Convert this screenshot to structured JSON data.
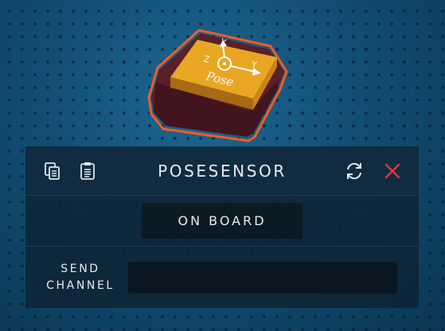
{
  "scene": {
    "block_label": "Pose",
    "axis_labels": {
      "x": "X",
      "y": "Y",
      "z": "Z"
    }
  },
  "panel": {
    "title": "POSESENSOR",
    "mode_button_label": "ON BOARD",
    "send_channel_label_line1": "SEND",
    "send_channel_label_line2": "CHANNEL",
    "send_channel_value": ""
  },
  "icons": [
    "copy-icon",
    "paste-icon",
    "refresh-icon",
    "close-icon"
  ],
  "colors": {
    "block_orange": "#e8a623",
    "selection_outline": "#ff5a1f",
    "close_red": "#e0353f",
    "panel_bg": "#0e2638",
    "text": "#e6edf2"
  }
}
